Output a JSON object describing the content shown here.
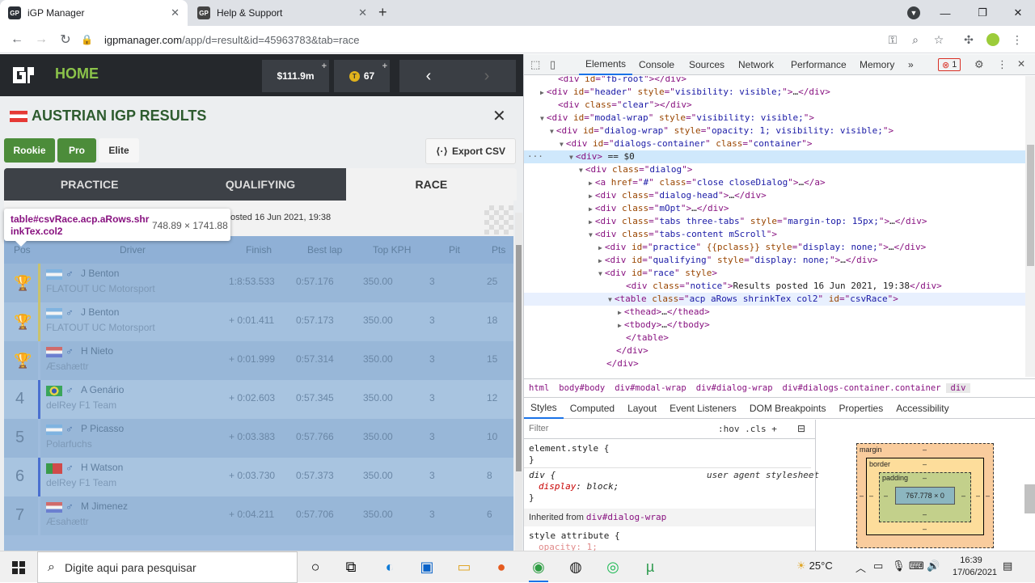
{
  "browser": {
    "tabs": [
      {
        "title": "iGP Manager",
        "active": true
      },
      {
        "title": "Help & Support",
        "active": false
      }
    ],
    "new_tab": "+",
    "window_controls": {
      "minimize": "—",
      "restore": "❐",
      "close": "✕"
    },
    "url_host": "igpmanager.com",
    "url_path": "/app/d=result&id=45963783&tab=race"
  },
  "igp": {
    "nav_title": "HOME",
    "money": "$111.9m",
    "tokens": "67",
    "plus": "+",
    "dialog": {
      "title": "AUSTRIAN IGP RESULTS",
      "close": "✕",
      "tiers": [
        "Rookie",
        "Pro",
        "Elite"
      ],
      "export": "Export CSV",
      "session_tabs": [
        "PRACTICE",
        "QUALIFYING",
        "RACE"
      ],
      "notice": "osted 16 Jun 2021, 19:38"
    },
    "table": {
      "headers": {
        "pos": "Pos",
        "driver": "Driver",
        "finish": "Finish",
        "best_lap": "Best lap",
        "top_kph": "Top KPH",
        "pit": "Pit",
        "pts": "Pts"
      },
      "rows": [
        {
          "pos": "",
          "trophy": true,
          "driver": "J Benton",
          "team": "FLATOUT UC Motorsport",
          "finish": "1:8:53.533",
          "best_lap": "0:57.176",
          "top_kph": "350.00",
          "pit": "3",
          "pts": "25",
          "bar": "#c9c26e",
          "flag": "ar"
        },
        {
          "pos": "",
          "trophy": true,
          "driver": "J Benton",
          "team": "FLATOUT UC Motorsport",
          "finish": "+ 0:01.411",
          "best_lap": "0:57.173",
          "top_kph": "350.00",
          "pit": "3",
          "pts": "18",
          "bar": "#c9c26e",
          "flag": "ar"
        },
        {
          "pos": "",
          "trophy": true,
          "driver": "H Nieto",
          "team": "Æsahættr",
          "finish": "+ 0:01.999",
          "best_lap": "0:57.314",
          "top_kph": "350.00",
          "pit": "3",
          "pts": "15",
          "bar": "#9fbcdd",
          "flag": "py"
        },
        {
          "pos": "4",
          "trophy": false,
          "driver": "A Genário",
          "team": "delRey F1 Team",
          "finish": "+ 0:02.603",
          "best_lap": "0:57.345",
          "top_kph": "350.00",
          "pit": "3",
          "pts": "12",
          "bar": "#4a6fd0",
          "flag": "br"
        },
        {
          "pos": "5",
          "trophy": false,
          "driver": "P Picasso",
          "team": "Polarfuchs",
          "finish": "+ 0:03.383",
          "best_lap": "0:57.766",
          "top_kph": "350.00",
          "pit": "3",
          "pts": "10",
          "bar": "#9fbcdd",
          "flag": "ar"
        },
        {
          "pos": "6",
          "trophy": false,
          "driver": "H Watson",
          "team": "delRey F1 Team",
          "finish": "+ 0:03.730",
          "best_lap": "0:57.373",
          "top_kph": "350.00",
          "pit": "3",
          "pts": "8",
          "bar": "#4a6fd0",
          "flag": "pt"
        },
        {
          "pos": "7",
          "trophy": false,
          "driver": "M Jimenez",
          "team": "Æsahættr",
          "finish": "+ 0:04.211",
          "best_lap": "0:57.706",
          "top_kph": "350.00",
          "pit": "3",
          "pts": "6",
          "bar": "#9fbcdd",
          "flag": "py"
        }
      ]
    },
    "tooltip": {
      "selector": "table#csvRace.acp.aRows.shrinkTex.col2",
      "size": "748.89 × 1741.88"
    }
  },
  "devtools": {
    "tabs": [
      "Elements",
      "Console",
      "Sources",
      "Network",
      "Performance",
      "Memory",
      "»"
    ],
    "error_count": "1",
    "dom_lines": [
      {
        "indent": 3,
        "html": "<span>&lt;div </span><span class='an'>id</span>=\"<span class='av'>fb-root</span>\"&gt;&lt;/div&gt;"
      },
      {
        "indent": 2,
        "tri": "▶",
        "html": "&lt;div <span class='an'>id</span>=\"<span class='av'>header</span>\" <span class='an'>style</span>=\"<span class='av'>visibility: visible;</span>\"&gt;<span class='tx'>…</span>&lt;/div&gt;"
      },
      {
        "indent": 3,
        "html": "&lt;div <span class='an'>class</span>=\"<span class='av'>clear</span>\"&gt;&lt;/div&gt;"
      },
      {
        "indent": 2,
        "tri": "▼",
        "html": "&lt;div <span class='an'>id</span>=\"<span class='av'>modal-wrap</span>\" <span class='an'>style</span>=\"<span class='av'>visibility: visible;</span>\"&gt;"
      },
      {
        "indent": 3,
        "tri": "▼",
        "html": "&lt;div <span class='an'>id</span>=\"<span class='av'>dialog-wrap</span>\" <span class='an'>style</span>=\"<span class='av'>opacity: 1; visibility: visible;</span>\"&gt;"
      },
      {
        "indent": 4,
        "tri": "▼",
        "html": "&lt;div <span class='an'>id</span>=\"<span class='av'>dialogs-container</span>\" <span class='an'>class</span>=\"<span class='av'>container</span>\"&gt;"
      },
      {
        "indent": 5,
        "tri": "▼",
        "sel": true,
        "html": "&lt;div&gt; <span class='tx'>== $0</span>"
      },
      {
        "indent": 6,
        "tri": "▼",
        "html": "&lt;div <span class='an'>class</span>=\"<span class='av'>dialog</span>\"&gt;"
      },
      {
        "indent": 7,
        "tri": "▶",
        "html": "&lt;a <span class='an'>href</span>=\"<span class='av'>#</span>\" <span class='an'>class</span>=\"<span class='av'>close closeDialog</span>\"&gt;<span class='tx'>…</span>&lt;/a&gt;"
      },
      {
        "indent": 7,
        "tri": "▶",
        "html": "&lt;div <span class='an'>class</span>=\"<span class='av'>dialog-head</span>\"&gt;<span class='tx'>…</span>&lt;/div&gt;"
      },
      {
        "indent": 7,
        "tri": "▶",
        "html": "&lt;div <span class='an'>class</span>=\"<span class='av'>mOpt</span>\"&gt;<span class='tx'>…</span>&lt;/div&gt;"
      },
      {
        "indent": 7,
        "tri": "▶",
        "html": "&lt;div <span class='an'>class</span>=\"<span class='av'>tabs three-tabs</span>\" <span class='an'>style</span>=\"<span class='av'>margin-top: 15px;</span>\"&gt;<span class='tx'>…</span>&lt;/div&gt;"
      },
      {
        "indent": 7,
        "tri": "▼",
        "html": "&lt;div <span class='an'>class</span>=\"<span class='av'>tabs-content mScroll</span>\"&gt;"
      },
      {
        "indent": 8,
        "tri": "▶",
        "html": "&lt;div <span class='an'>id</span>=\"<span class='av'>practice</span>\" <span class='an'>{{pclass}}</span> <span class='an'>style</span>=\"<span class='av'>display: none;</span>\"&gt;<span class='tx'>…</span>&lt;/div&gt;"
      },
      {
        "indent": 8,
        "tri": "▶",
        "html": "&lt;div <span class='an'>id</span>=\"<span class='av'>qualifying</span>\" <span class='an'>style</span>=\"<span class='av'>display: none;</span>\"&gt;<span class='tx'>…</span>&lt;/div&gt;"
      },
      {
        "indent": 8,
        "tri": "▼",
        "html": "&lt;div <span class='an'>id</span>=\"<span class='av'>race</span>\" <span class='an'>style</span>&gt;"
      },
      {
        "indent": 10,
        "html": "&lt;div <span class='an'>class</span>=\"<span class='av'>notice</span>\"&gt;<span class='tx'>Results posted 16 Jun 2021, 19:38</span>&lt;/div&gt;"
      },
      {
        "indent": 9,
        "tri": "▼",
        "hov": true,
        "html": "&lt;table <span class='an'>class</span>=\"<span class='av'>acp aRows shrinkTex col2</span>\" <span class='an'>id</span>=\"<span class='av'>csvRace</span>\"&gt;"
      },
      {
        "indent": 10,
        "tri": "▶",
        "html": "&lt;thead&gt;<span class='tx'>…</span>&lt;/thead&gt;"
      },
      {
        "indent": 10,
        "tri": "▶",
        "html": "&lt;tbody&gt;<span class='tx'>…</span>&lt;/tbody&gt;"
      },
      {
        "indent": 10,
        "html": "&lt;/table&gt;"
      },
      {
        "indent": 9,
        "html": "&lt;/div&gt;"
      },
      {
        "indent": 8,
        "html": "&lt;/div&gt;"
      }
    ],
    "breadcrumbs": [
      "html",
      "body#body",
      "div#modal-wrap",
      "div#dialog-wrap",
      "div#dialogs-container.container",
      "div"
    ],
    "subtabs": [
      "Styles",
      "Computed",
      "Layout",
      "Event Listeners",
      "DOM Breakpoints",
      "Properties",
      "Accessibility"
    ],
    "filter_placeholder": "Filter",
    "hov_cls": ":hov  .cls  +",
    "styles": {
      "element_style": "element.style {",
      "close_brace": "}",
      "div_rule": "div {",
      "ua_label": "user agent stylesheet",
      "display_prop": "display",
      "display_val": " block;",
      "inherited_label": "Inherited from ",
      "inherited_from": "div#dialog-wrap",
      "style_attr": "style attribute {",
      "opacity_prop": "opacity",
      "opacity_val": " 1;"
    },
    "box_model": {
      "margin": "margin",
      "border": "border",
      "padding": "padding",
      "dash": "–",
      "content": "767.778 × 0"
    }
  },
  "taskbar": {
    "search_placeholder": "Digite aqui para pesquisar",
    "temperature": "25°C",
    "time": "16:39",
    "date": "17/06/2021"
  }
}
